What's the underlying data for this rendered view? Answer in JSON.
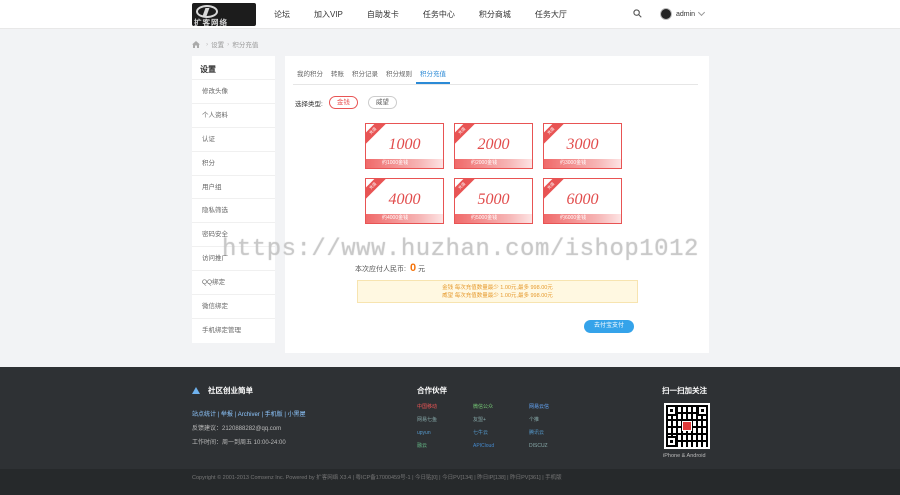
{
  "header": {
    "logo_text": "扩客网络",
    "nav": [
      "论坛",
      "加入VIP",
      "自助发卡",
      "任务中心",
      "积分商城",
      "任务大厅"
    ],
    "username": "admin"
  },
  "breadcrumb": [
    "设置",
    "积分充值"
  ],
  "sidebar": {
    "title": "设置",
    "items": [
      "修改头像",
      "个人资料",
      "认证",
      "积分",
      "用户组",
      "隐私筛选",
      "密码安全",
      "访问推广",
      "QQ绑定",
      "微信绑定",
      "手机绑定管理"
    ]
  },
  "main": {
    "tabs": [
      "我的积分",
      "转账",
      "积分记录",
      "积分规则",
      "积分充值"
    ],
    "active_tab": 4,
    "type_label": "选择类型:",
    "types": [
      "金钱",
      "威望"
    ],
    "selected_type": 0,
    "cards": [
      {
        "amount": "1000",
        "strip": "约1000金钱",
        "ribbon": "充值"
      },
      {
        "amount": "2000",
        "strip": "约2000金钱",
        "ribbon": "充值"
      },
      {
        "amount": "3000",
        "strip": "约3000金钱",
        "ribbon": "充值"
      },
      {
        "amount": "4000",
        "strip": "约4000金钱",
        "ribbon": "充值"
      },
      {
        "amount": "5000",
        "strip": "约5000金钱",
        "ribbon": "充值"
      },
      {
        "amount": "6000",
        "strip": "约6000金钱",
        "ribbon": "充值"
      }
    ],
    "price_label": "本次应付人民币:",
    "price_value": "0",
    "price_unit": "元",
    "notice_line1": "金钱 每次充值数量最少 1.00元,最多 998.00元",
    "notice_line2": "威望 每次充值数量最少 1.00元,最多 998.00元",
    "pay_button": "去付宝支付"
  },
  "watermark": "https://www.huzhan.com/ishop1012",
  "footer": {
    "about_title": "社区创业简单",
    "links": "站点统计 | 举报 | Archiver | 手机版 | 小黑屋",
    "email": "反馈建议：2120888282@qq.com",
    "hours": "工作时间：周一到周五 10:00-24:00",
    "partners_title": "合作伙伴",
    "partners": [
      "中国移动",
      "微信公众",
      "网易云信",
      "网易七鱼",
      "友盟+",
      "个推",
      "upyun",
      "七牛云",
      "腾讯云",
      "融云",
      "APICloud",
      "DISCUZ"
    ],
    "qr_title": "扫一扫加关注",
    "qr_caption": "iPhone & Android",
    "copyright": "Copyright © 2001-2013 Comsenz Inc. Powered by 扩客网络 X3.4 | 粤ICP备17000459号-1 | 今日贴[0] | 今日PV[134] | 昨日IP[138] | 昨日PV[361] | 手机版"
  }
}
